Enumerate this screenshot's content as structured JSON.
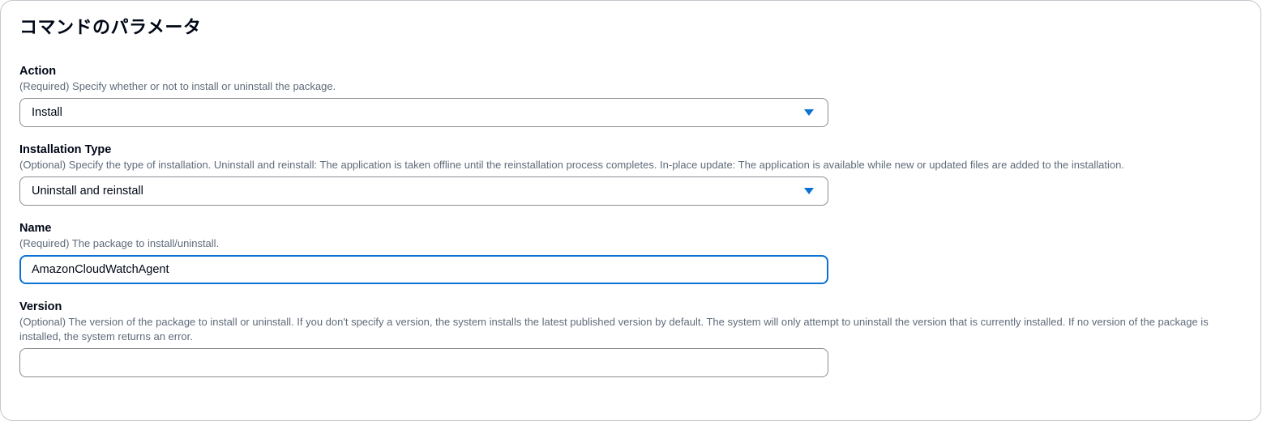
{
  "section": {
    "title": "コマンドのパラメータ"
  },
  "fields": {
    "action": {
      "label": "Action",
      "description": "(Required) Specify whether or not to install or uninstall the package.",
      "value": "Install"
    },
    "installation_type": {
      "label": "Installation Type",
      "description": "(Optional) Specify the type of installation. Uninstall and reinstall: The application is taken offline until the reinstallation process completes. In-place update: The application is available while new or updated files are added to the installation.",
      "value": "Uninstall and reinstall"
    },
    "name": {
      "label": "Name",
      "description": "(Required) The package to install/uninstall.",
      "value": "AmazonCloudWatchAgent"
    },
    "version": {
      "label": "Version",
      "description": "(Optional) The version of the package to install or uninstall. If you don't specify a version, the system installs the latest published version by default. The system will only attempt to uninstall the version that is currently installed. If no version of the package is installed, the system returns an error.",
      "value": ""
    }
  },
  "colors": {
    "accent": "#0972d3",
    "text": "#000716",
    "muted": "#5f6b7a",
    "border": "#8c8c94"
  },
  "icons": {
    "select_caret": "caret-down-icon"
  }
}
